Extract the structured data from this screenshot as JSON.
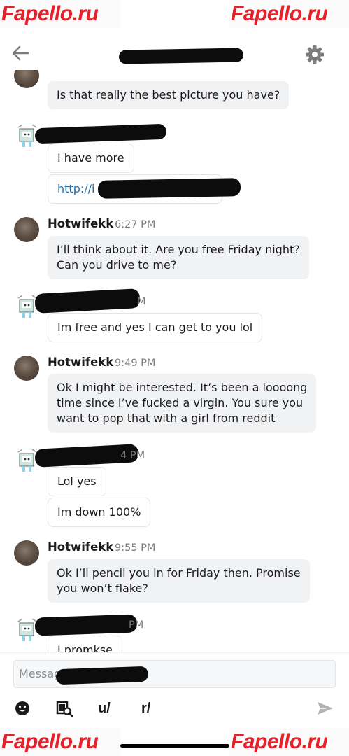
{
  "watermark": "Fapello.ru",
  "header": {
    "back_icon": "arrow-left-icon",
    "settings_icon": "gear-icon"
  },
  "messages": [
    {
      "text": "Is that really the best picture you have?"
    },
    {
      "text": "I have more"
    },
    {
      "text": "http://i"
    },
    {
      "user": "Hotwifekk",
      "time": "6:27 PM",
      "text_lines": [
        "I’ll think about it. Are you free Friday night?",
        "Can you drive to me?"
      ]
    },
    {
      "time_fragment": "M",
      "text": "Im free and yes I can get to you lol"
    },
    {
      "user": "Hotwifekk",
      "time": "9:49 PM",
      "text_lines": [
        "Ok I might be interested. It’s been a loooong",
        "time since I’ve fucked a virgin. You sure you",
        "want to pop that with a girl from reddit"
      ]
    },
    {
      "time_fragment": "4 PM",
      "text": "Lol yes"
    },
    {
      "text": "Im down 100%"
    },
    {
      "user": "Hotwifekk",
      "time": "9:55 PM",
      "text_lines": [
        "Ok I’ll pencil you in for Friday then. Promise",
        "you won’t flake?"
      ]
    },
    {
      "time_fragment": "PM",
      "text": "I promkse"
    }
  ],
  "composer": {
    "placeholder": "Message",
    "tools": [
      "emoji-icon",
      "gif-search-icon",
      "u/",
      "r/"
    ],
    "send_icon": "send-icon"
  }
}
